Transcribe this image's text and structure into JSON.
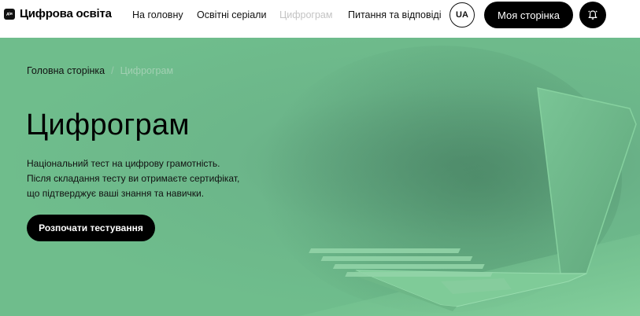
{
  "header": {
    "logo_mark": "дія",
    "logo_text": "Цифрова освіта",
    "nav": [
      {
        "label": "На головну"
      },
      {
        "label": "Освітні серіали"
      },
      {
        "label": "Цифрограм"
      },
      {
        "label": "Питання та відповіді"
      }
    ],
    "lang_label": "UA",
    "my_page_label": "Моя сторінка",
    "bell_icon": "alarm-bell-icon"
  },
  "breadcrumb": {
    "home": "Головна сторінка",
    "separator": "/",
    "current": "Цифрограм"
  },
  "hero": {
    "title": "Цифрограм",
    "description": [
      "Національний тест на цифрову грамотність.",
      "Після складання тесту ви отримаєте сертифікат,",
      "що підтверджує ваші знання та навички."
    ],
    "cta_label": "Розпочати тестування",
    "illustration": "laptop-illustration"
  },
  "colors": {
    "hero_bg": "#6fbd8c",
    "button_bg": "#000000",
    "active_nav": "#c4c4c4"
  }
}
